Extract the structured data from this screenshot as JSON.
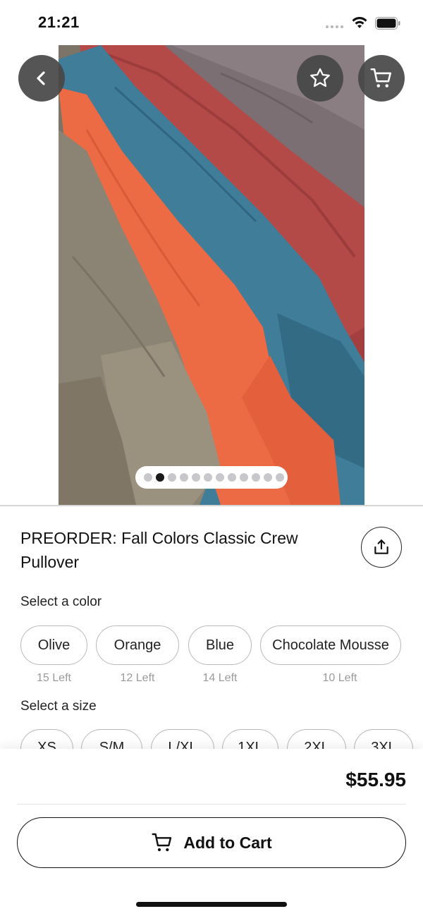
{
  "status_bar": {
    "time": "21:21"
  },
  "icons": {
    "back": "chevron-left-icon",
    "favorite": "star-outline-icon",
    "cart": "cart-icon",
    "share": "share-icon",
    "wifi": "wifi-icon",
    "battery": "battery-icon"
  },
  "gallery": {
    "page_count": 12,
    "active_index": 1
  },
  "product": {
    "title": "PREORDER: Fall Colors Classic Crew Pullover"
  },
  "color_section": {
    "label": "Select a color",
    "options": [
      {
        "name": "Olive",
        "stock": "15 Left"
      },
      {
        "name": "Orange",
        "stock": "12 Left"
      },
      {
        "name": "Blue",
        "stock": "14 Left"
      },
      {
        "name": "Chocolate Mousse",
        "stock": "10 Left"
      }
    ]
  },
  "size_section": {
    "label": "Select a size",
    "options": [
      "XS",
      "S/M",
      "L/XL",
      "1XL",
      "2XL",
      "3XL"
    ]
  },
  "footer": {
    "price": "$55.95",
    "add_to_cart_label": "Add to Cart"
  },
  "colors": {
    "accent": "#111111",
    "chip_border": "#b9b9b9",
    "stock_text": "#9a9a9a",
    "floating_button_bg": "#464646"
  }
}
